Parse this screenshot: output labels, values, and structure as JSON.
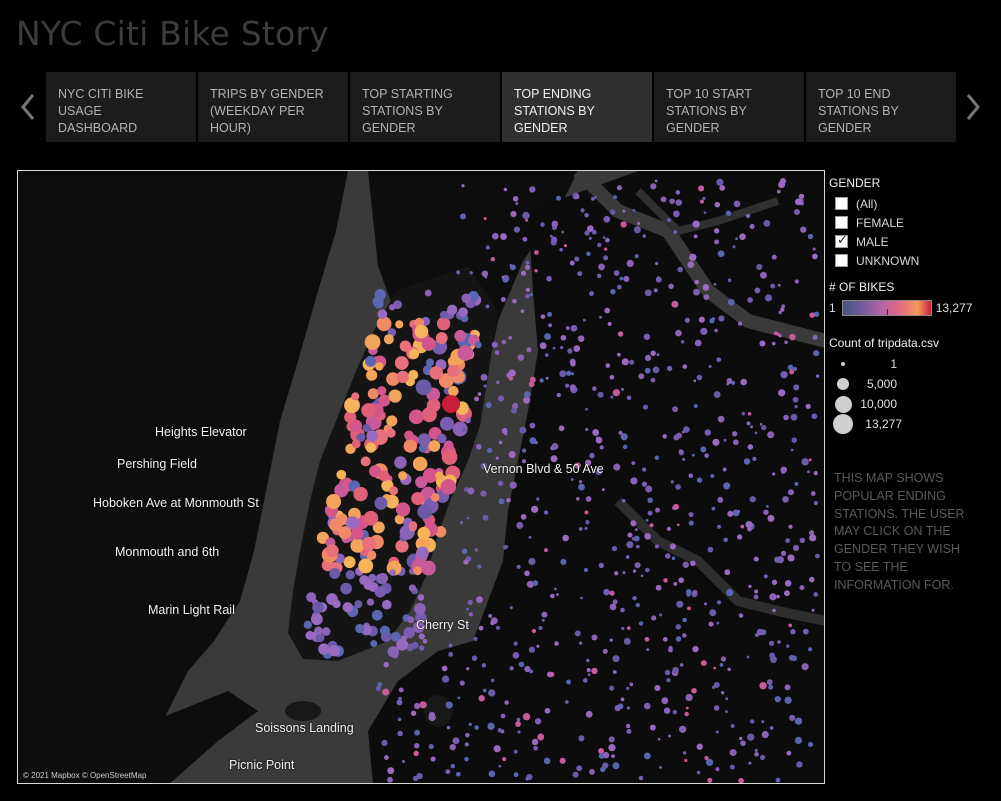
{
  "title": "NYC Citi Bike Story",
  "nav": {
    "prev_icon": "chevron-left-icon",
    "next_icon": "chevron-right-icon"
  },
  "tabs": [
    {
      "label": "NYC CITI BIKE USAGE DASHBOARD",
      "active": false
    },
    {
      "label": "TRIPS BY GENDER (WEEKDAY PER HOUR)",
      "active": false
    },
    {
      "label": "TOP STARTING STATIONS BY GENDER",
      "active": false
    },
    {
      "label": "TOP ENDING STATIONS BY GENDER",
      "active": true
    },
    {
      "label": "TOP 10 START STATIONS BY GENDER",
      "active": false
    },
    {
      "label": "TOP 10 END STATIONS BY GENDER",
      "active": false
    }
  ],
  "map": {
    "labels": [
      "Heights Elevator",
      "Pershing Field",
      "Hoboken Ave at Monmouth St",
      "Monmouth and 6th",
      "Marin Light Rail",
      "Vernon Blvd & 50 Ave",
      "Cherry St",
      "Soissons Landing",
      "Picnic Point"
    ],
    "attribution": "© 2021 Mapbox © OpenStreetMap"
  },
  "legend": {
    "gender_heading": "GENDER",
    "gender_options": [
      {
        "label": "(All)",
        "checked": false
      },
      {
        "label": "FEMALE",
        "checked": false
      },
      {
        "label": "MALE",
        "checked": true
      },
      {
        "label": "UNKNOWN",
        "checked": false
      }
    ],
    "bikes_heading": "# OF BIKES",
    "bikes_min": "1",
    "bikes_max": "13,277",
    "count_heading": "Count of tripdata.csv",
    "count_values": [
      "1",
      "5,000",
      "10,000",
      "13,277"
    ]
  },
  "note": "THIS MAP SHOWS POPULAR ENDING STATIONS. THE USER MAY CLICK ON THE GENDER THEY WISH TO SEE THE INFORMATION FOR."
}
